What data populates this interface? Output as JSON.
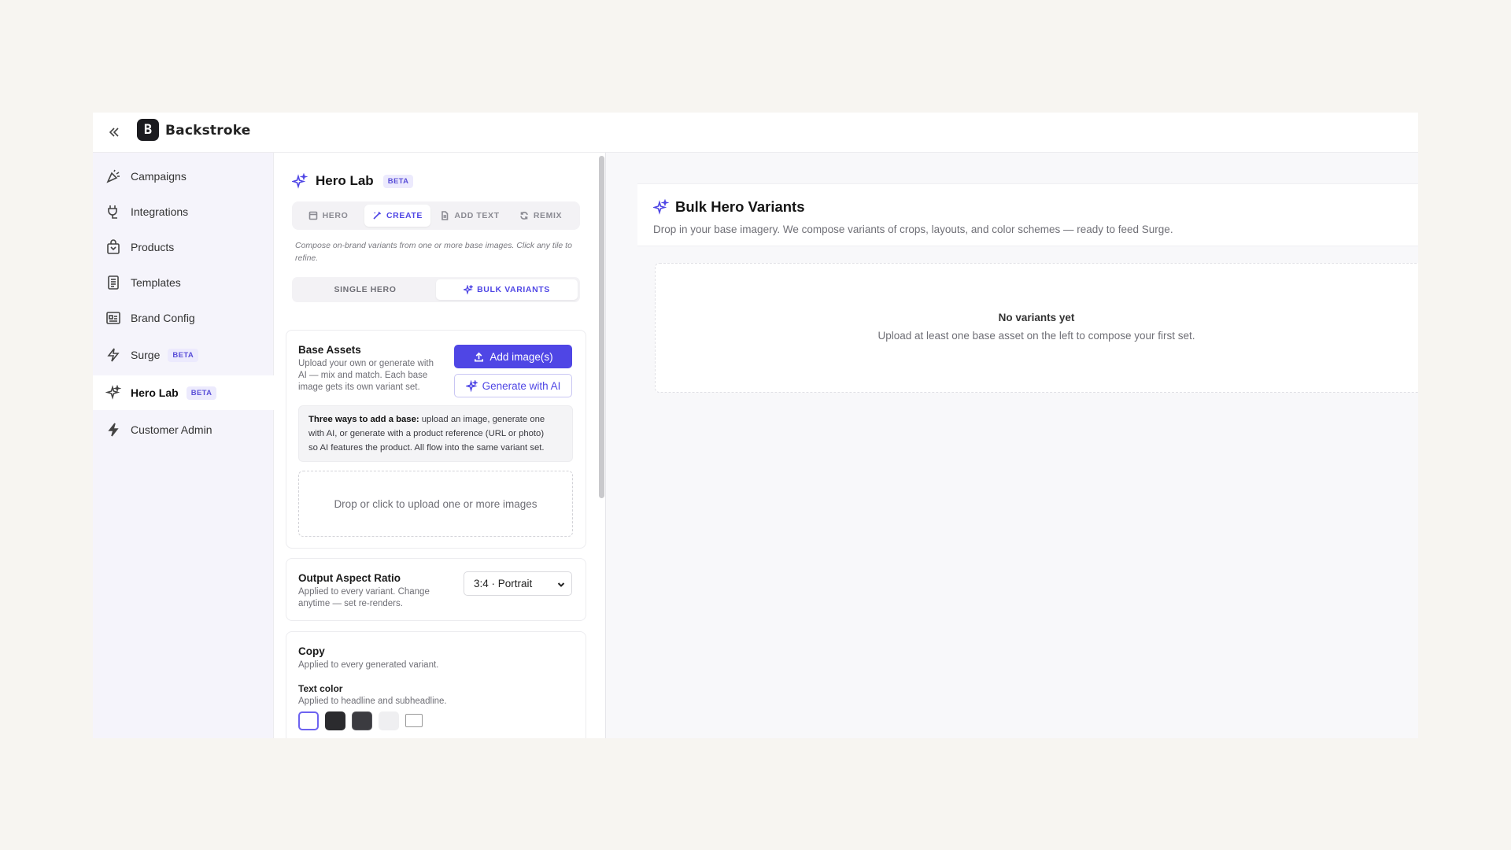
{
  "topbar": {
    "brand": "Backstroke",
    "logo_letter": "B"
  },
  "sidebar": {
    "items": [
      {
        "label": "Campaigns",
        "icon": "megaphone-icon"
      },
      {
        "label": "Integrations",
        "icon": "plug-icon"
      },
      {
        "label": "Products",
        "icon": "shopping-bag-icon"
      },
      {
        "label": "Templates",
        "icon": "file-text-icon"
      },
      {
        "label": "Brand Config",
        "icon": "id-card-icon"
      },
      {
        "label": "Surge",
        "icon": "lightning-icon",
        "badge": "BETA"
      },
      {
        "label": "Hero Lab",
        "icon": "sparkles-icon",
        "badge": "BETA",
        "active": true
      },
      {
        "label": "Customer Admin",
        "icon": "bolt-icon"
      }
    ]
  },
  "panel": {
    "title": "Hero Lab",
    "title_badge": "BETA",
    "mode_tabs": [
      "HERO",
      "CREATE",
      "ADD TEXT",
      "REMIX"
    ],
    "active_mode_tab": "CREATE",
    "hint": "Compose on-brand variants from one or more base images. Click any tile to refine.",
    "sub_tabs": [
      "SINGLE HERO",
      "BULK VARIANTS"
    ],
    "active_sub_tab": "BULK VARIANTS",
    "base_assets": {
      "title": "Base Assets",
      "desc_line1": "Upload your own or generate with",
      "desc_line2": "AI — mix and match. Each base",
      "desc_line3": "image gets its own variant set.",
      "add_button": "Add image(s)",
      "generate_button": "Generate with AI",
      "info_bold": "Three ways to add a base:",
      "info_line1": " upload an image, generate one",
      "info_line2": "with AI, or generate with a product reference (URL or photo)",
      "info_line3": "so AI features the product. All flow into the same variant set.",
      "dropzone": "Drop or click to upload one or more images"
    },
    "aspect": {
      "title": "Output Aspect Ratio",
      "desc_line1": "Applied to every variant. Change",
      "desc_line2": "anytime — set re-renders.",
      "selected": "3:4 · Portrait"
    },
    "copy": {
      "title": "Copy",
      "desc": "Applied to every generated variant.",
      "text_color_label": "Text color",
      "text_color_desc": "Applied to headline and subheadline.",
      "swatches": [
        "#ffffff",
        "#2b2b2e",
        "#3b3b40",
        "#efeff1",
        "#ffffff"
      ]
    }
  },
  "main": {
    "title": "Bulk Hero Variants",
    "desc": "Drop in your base imagery. We compose variants of crops, layouts, and color schemes — ready to feed Surge.",
    "empty_title": "No variants yet",
    "empty_desc": "Upload at least one base asset on the left to compose your first set."
  },
  "colors": {
    "accent": "#4f46e5",
    "sidebar_bg": "#f5f4fb",
    "page_bg": "#f7f5f1"
  }
}
